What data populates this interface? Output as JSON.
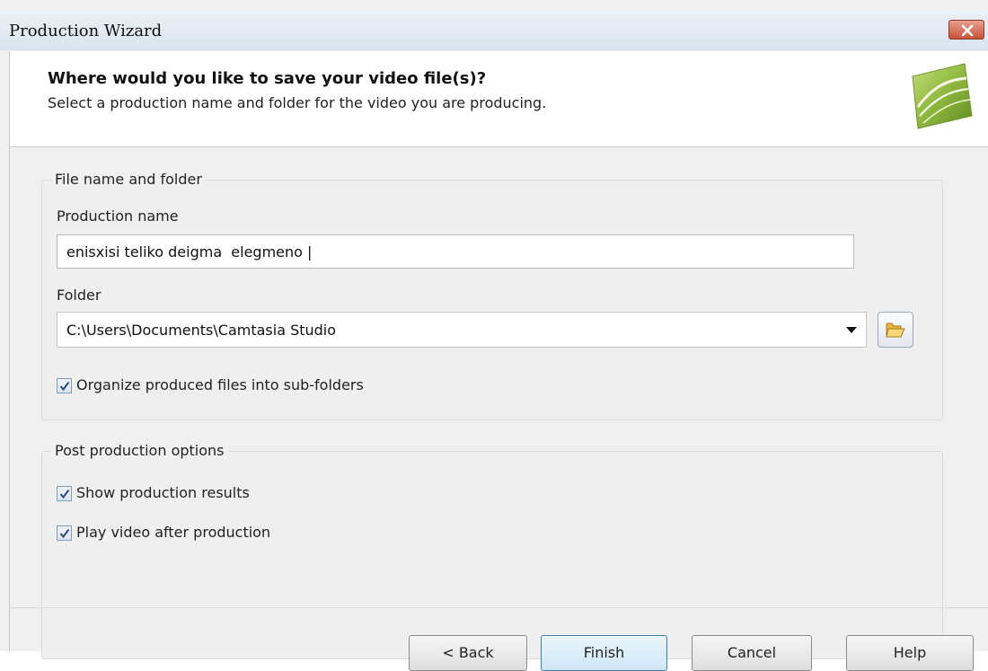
{
  "window": {
    "title": "Production Wizard",
    "close_icon": "close-icon"
  },
  "header": {
    "heading": "Where would you like to save your video file(s)?",
    "subheading": "Select a production name and folder for the video you are producing.",
    "logo_icon": "camtasia-logo-icon"
  },
  "file_group": {
    "legend": "File name and folder",
    "production_name_label": "Production name",
    "production_name_value": "enisxisi teliko deigma  elegmeno |",
    "folder_label": "Folder",
    "folder_value": "C:\\Users\\Documents\\Camtasia Studio",
    "browse_icon": "folder-open-icon",
    "organize_label": "Organize produced files into sub-folders",
    "organize_checked": true
  },
  "post_group": {
    "legend": "Post production options",
    "show_results_label": "Show production results",
    "show_results_checked": true,
    "play_video_label": "Play video after production",
    "play_video_checked": true
  },
  "buttons": {
    "back": "< Back",
    "finish": "Finish",
    "cancel": "Cancel",
    "help": "Help"
  },
  "colors": {
    "logo_green": "#8fb840",
    "close_red": "#c8523a",
    "checkmark": "#2b4d7a"
  }
}
